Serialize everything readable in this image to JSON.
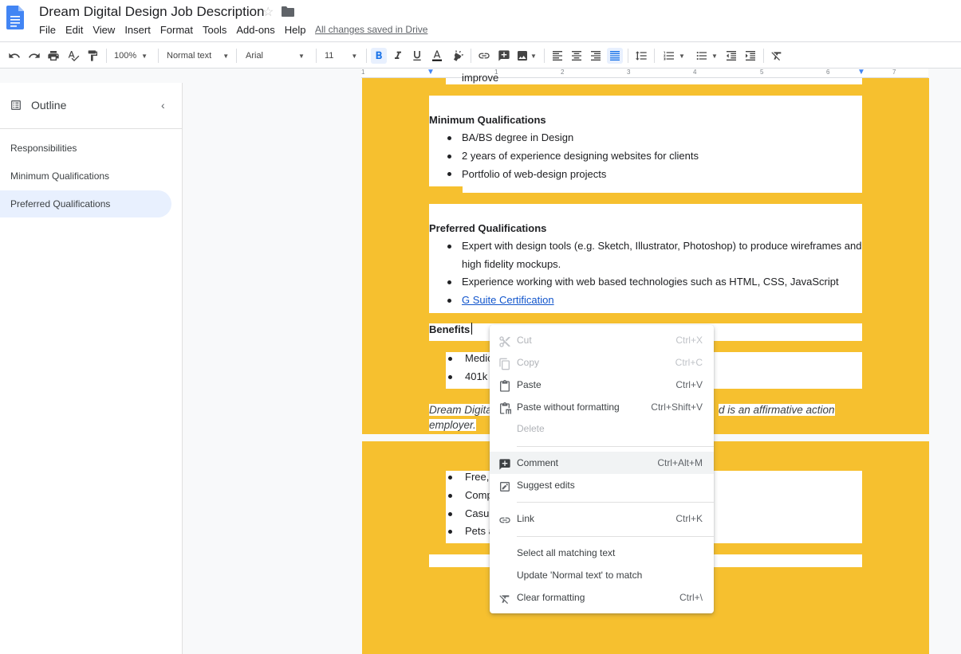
{
  "header": {
    "title": "Dream Digital Design Job Description",
    "saved_status": "All changes saved in Drive",
    "menu": [
      "File",
      "Edit",
      "View",
      "Insert",
      "Format",
      "Tools",
      "Add-ons",
      "Help"
    ]
  },
  "toolbar": {
    "zoom": "100%",
    "style": "Normal text",
    "font": "Arial",
    "size": "11",
    "icons": [
      "undo-icon",
      "redo-icon",
      "print-icon",
      "spellcheck-icon",
      "paint-format-icon",
      "bold-icon",
      "italic-icon",
      "underline-icon",
      "text-color-icon",
      "highlight-icon",
      "link-icon",
      "comment-icon",
      "image-icon",
      "align-left-icon",
      "align-center-icon",
      "align-right-icon",
      "justify-icon",
      "line-spacing-icon",
      "numbered-list-icon",
      "bulleted-list-icon",
      "decrease-indent-icon",
      "increase-indent-icon",
      "clear-formatting-icon"
    ]
  },
  "ruler": {
    "marks": [
      "1",
      "1",
      "2",
      "3",
      "4",
      "5",
      "6",
      "7"
    ]
  },
  "sidebar": {
    "heading": "Outline",
    "items": [
      {
        "label": "Responsibilities"
      },
      {
        "label": "Minimum Qualifications"
      },
      {
        "label": "Preferred Qualifications"
      }
    ]
  },
  "document": {
    "top_fragment": "improve",
    "min_heading": "Minimum Qualifications",
    "min_items": [
      "BA/BS degree in Design",
      "2 years of experience designing websites for clients",
      "Portfolio of web-design projects"
    ],
    "pref_heading": "Preferred Qualifications",
    "pref_item1_line1": "Expert with design tools (e.g. Sketch, Illustrator, Photoshop) to produce wireframes and",
    "pref_item1_line2": "high fidelity mockups.",
    "pref_item2": "Experience working with web based technologies such as HTML, CSS, JavaScript",
    "pref_item3_link": "G Suite Certification",
    "benefits_heading": "Benefits",
    "benefit_items": [
      "Medic",
      "401k"
    ],
    "italic_line1_left": "Dream Digita",
    "italic_line1_right": "d is an affirmative action",
    "italic_line2": "employer.",
    "page2_items": [
      "Free,",
      "Comp",
      "Casu",
      "Pets a"
    ]
  },
  "context_menu": {
    "items": [
      {
        "label": "Cut",
        "shortcut": "Ctrl+X",
        "icon": "cut-icon",
        "disabled": true
      },
      {
        "label": "Copy",
        "shortcut": "Ctrl+C",
        "icon": "copy-icon",
        "disabled": true
      },
      {
        "label": "Paste",
        "shortcut": "Ctrl+V",
        "icon": "paste-icon",
        "disabled": false
      },
      {
        "label": "Paste without formatting",
        "shortcut": "Ctrl+Shift+V",
        "icon": "paste-plain-icon",
        "disabled": false
      },
      {
        "label": "Delete",
        "shortcut": "",
        "icon": "",
        "disabled": true
      },
      {
        "label": "Comment",
        "shortcut": "Ctrl+Alt+M",
        "icon": "add-comment-icon",
        "disabled": false
      },
      {
        "label": "Suggest edits",
        "shortcut": "",
        "icon": "suggest-edits-icon",
        "disabled": false
      },
      {
        "label": "Link",
        "shortcut": "Ctrl+K",
        "icon": "link-icon",
        "disabled": false
      },
      {
        "label": "Select all matching text",
        "shortcut": "",
        "icon": "",
        "disabled": false
      },
      {
        "label": "Update 'Normal text' to match",
        "shortcut": "",
        "icon": "",
        "disabled": false
      },
      {
        "label": "Clear formatting",
        "shortcut": "Ctrl+\\",
        "icon": "clear-formatting-icon",
        "disabled": false
      }
    ]
  },
  "colors": {
    "page_accent": "#f6c02f",
    "link": "#1155cc",
    "selected": "#1a73e8"
  }
}
